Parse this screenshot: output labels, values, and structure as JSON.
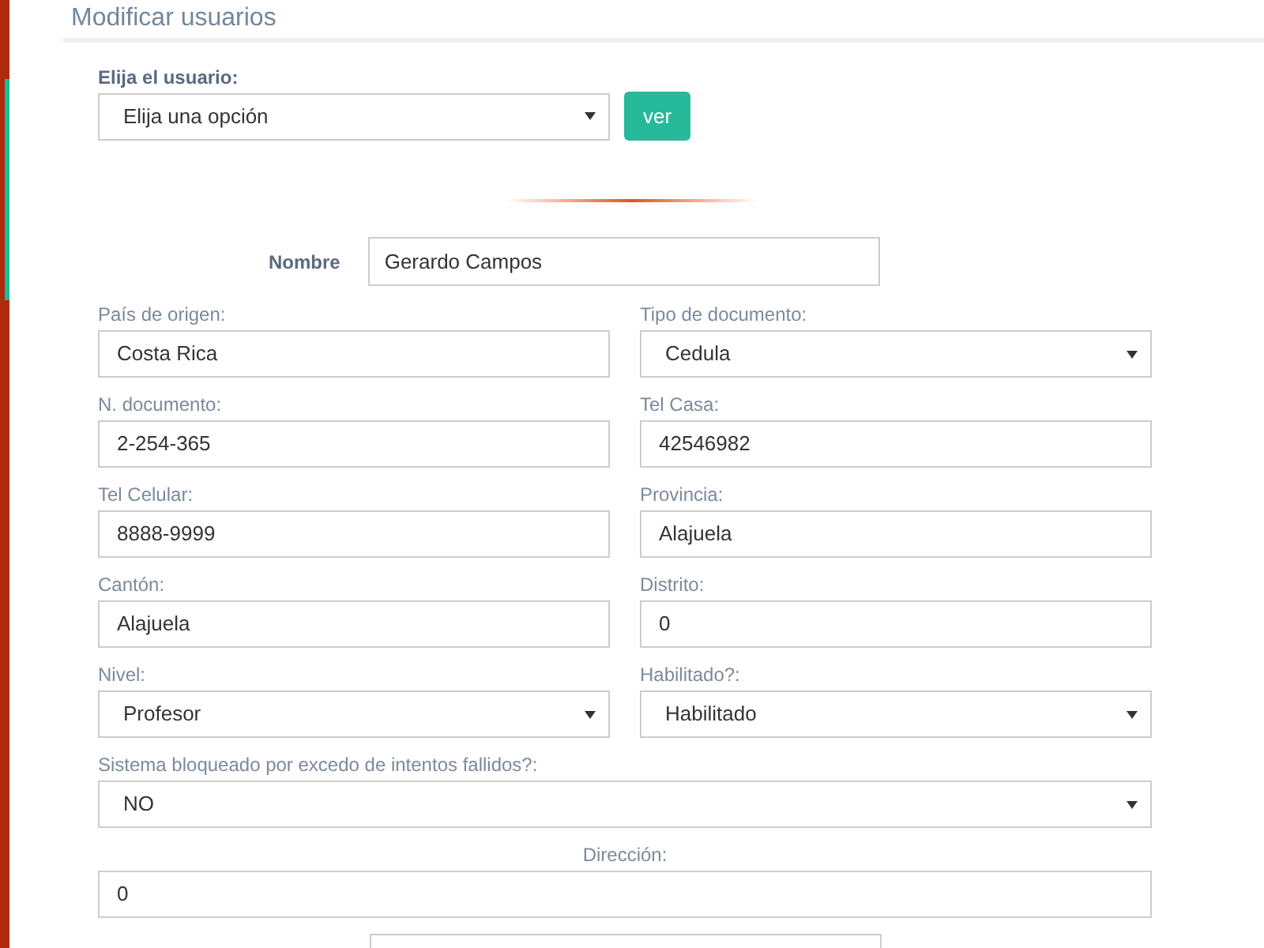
{
  "page_title": "Modificar usuarios",
  "user_picker": {
    "label": "Elija el usuario:",
    "value": "Elija una opción",
    "button": "ver"
  },
  "name_field": {
    "label": "Nombre",
    "value": "Gerardo Campos"
  },
  "fields": [
    {
      "label": "País de origen:",
      "value": "Costa Rica",
      "kind": "text"
    },
    {
      "label": "Tipo de documento:",
      "value": "Cedula",
      "kind": "select"
    },
    {
      "label": "N. documento:",
      "value": "2-254-365",
      "kind": "text"
    },
    {
      "label": "Tel Casa:",
      "value": "42546982",
      "kind": "text"
    },
    {
      "label": "Tel Celular:",
      "value": "8888-9999",
      "kind": "text"
    },
    {
      "label": "Provincia:",
      "value": "Alajuela",
      "kind": "text"
    },
    {
      "label": "Cantón:",
      "value": "Alajuela",
      "kind": "text"
    },
    {
      "label": "Distrito:",
      "value": "0",
      "kind": "text"
    },
    {
      "label": "Nivel:",
      "value": "Profesor",
      "kind": "select"
    },
    {
      "label": "Habilitado?:",
      "value": "Habilitado",
      "kind": "select"
    }
  ],
  "blocked_field": {
    "label": "Sistema bloqueado por excedo de intentos fallidos?:",
    "value": "NO",
    "kind": "select"
  },
  "address_field": {
    "label": "Dirección:",
    "value": "0",
    "kind": "text"
  }
}
